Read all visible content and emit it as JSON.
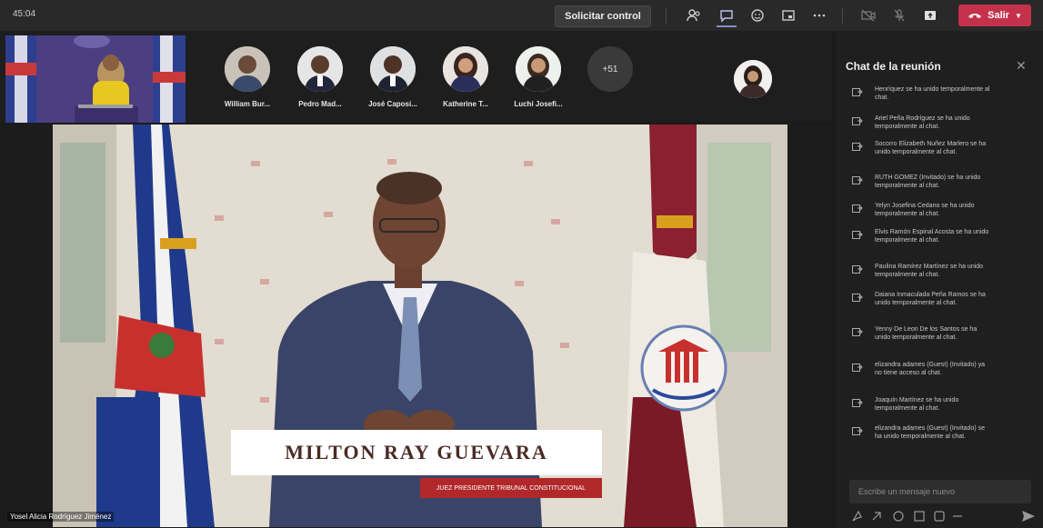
{
  "topbar": {
    "timer": "45:04",
    "control_button": "Solicitar control",
    "leave_label": "Salir"
  },
  "participants": [
    {
      "name": "William Bur..."
    },
    {
      "name": "Pedro Mad..."
    },
    {
      "name": "José Caposi..."
    },
    {
      "name": "Katherine T..."
    },
    {
      "name": "Luchi Josefi..."
    }
  ],
  "more_participants": "+51",
  "video": {
    "name": "MILTON RAY GUEVARA",
    "title": "JUEZ PRESIDENTE TRIBUNAL CONSTITUCIONAL",
    "bottom_label": "Yosel Alicia Rodríguez Jiménez"
  },
  "chat": {
    "title": "Chat de la reunión",
    "messages": [
      "Henríquez se ha unido temporalmente al chat.",
      "Ariel Peña Rodríguez se ha unido temporalmente al chat.",
      "Socorro Elizabeth Nuñez Marlero se ha unido temporalmente al chat.",
      "RUTH GOMEZ (Invitado) se ha unido temporalmente al chat.",
      "Yelyn Josefina Cedano se ha unido temporalmente al chat.",
      "Elvis Ramón Espinal Acosta se ha unido temporalmente al chat.",
      "Paulina Ramírez Martínez se ha unido temporalmente al chat.",
      "Daiana Inmaculada Peña Ramos se ha unido temporalmente al chat.",
      "Yenny De Leon De los Santos se ha unido temporalmente al chat.",
      "elizandra adames (Guest) (Invitado) ya no tiene acceso al chat.",
      "Joaquín Martínez se ha unido temporalmente al chat.",
      "elizandra adames (Guest) (Invitado) se ha unido temporalmente al chat."
    ],
    "compose_placeholder": "Escribe un mensaje nuevo"
  },
  "colors": {
    "leave": "#c4314b",
    "accent": "#8b8cc7",
    "name_sub": "#b0282a"
  }
}
